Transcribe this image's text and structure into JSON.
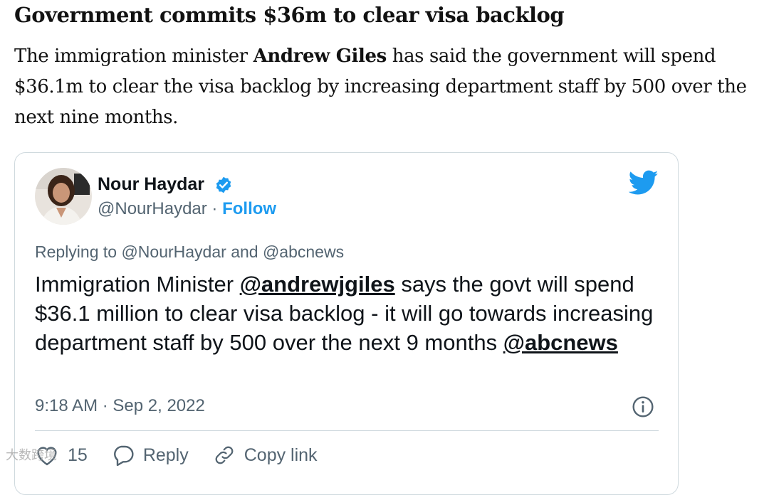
{
  "article": {
    "headline": "Government commits $36m to clear visa backlog",
    "body_prefix": "The immigration minister ",
    "body_name": "Andrew Giles",
    "body_suffix": " has said the government will spend $36.1m to clear the visa backlog by increasing department staff by 500 over the next nine months."
  },
  "tweet": {
    "author_name": "Nour Haydar",
    "handle": "@NourHaydar",
    "separator": " · ",
    "follow_label": "Follow",
    "reply_context": "Replying to @NourHaydar and @abcnews",
    "text_prefix": "Immigration Minister ",
    "mention_1": "@andrewjgiles",
    "text_middle": " says the govt will spend $36.1 million to clear visa backlog - it will go towards increasing department staff by 500 over the next 9 months ",
    "mention_2": "@abcnews",
    "timestamp": "9:18 AM · Sep 2, 2022",
    "like_count": "15",
    "reply_label": "Reply",
    "copy_link_label": "Copy link",
    "icons": {
      "verified": "verified-badge-icon",
      "brand": "twitter-bird-icon",
      "info": "info-icon",
      "like": "heart-icon",
      "reply": "speech-bubble-icon",
      "copy": "link-icon"
    },
    "colors": {
      "accent": "#1d9bf0",
      "muted": "#536471",
      "border": "#cfd9de"
    }
  },
  "watermark": "大数跨境"
}
